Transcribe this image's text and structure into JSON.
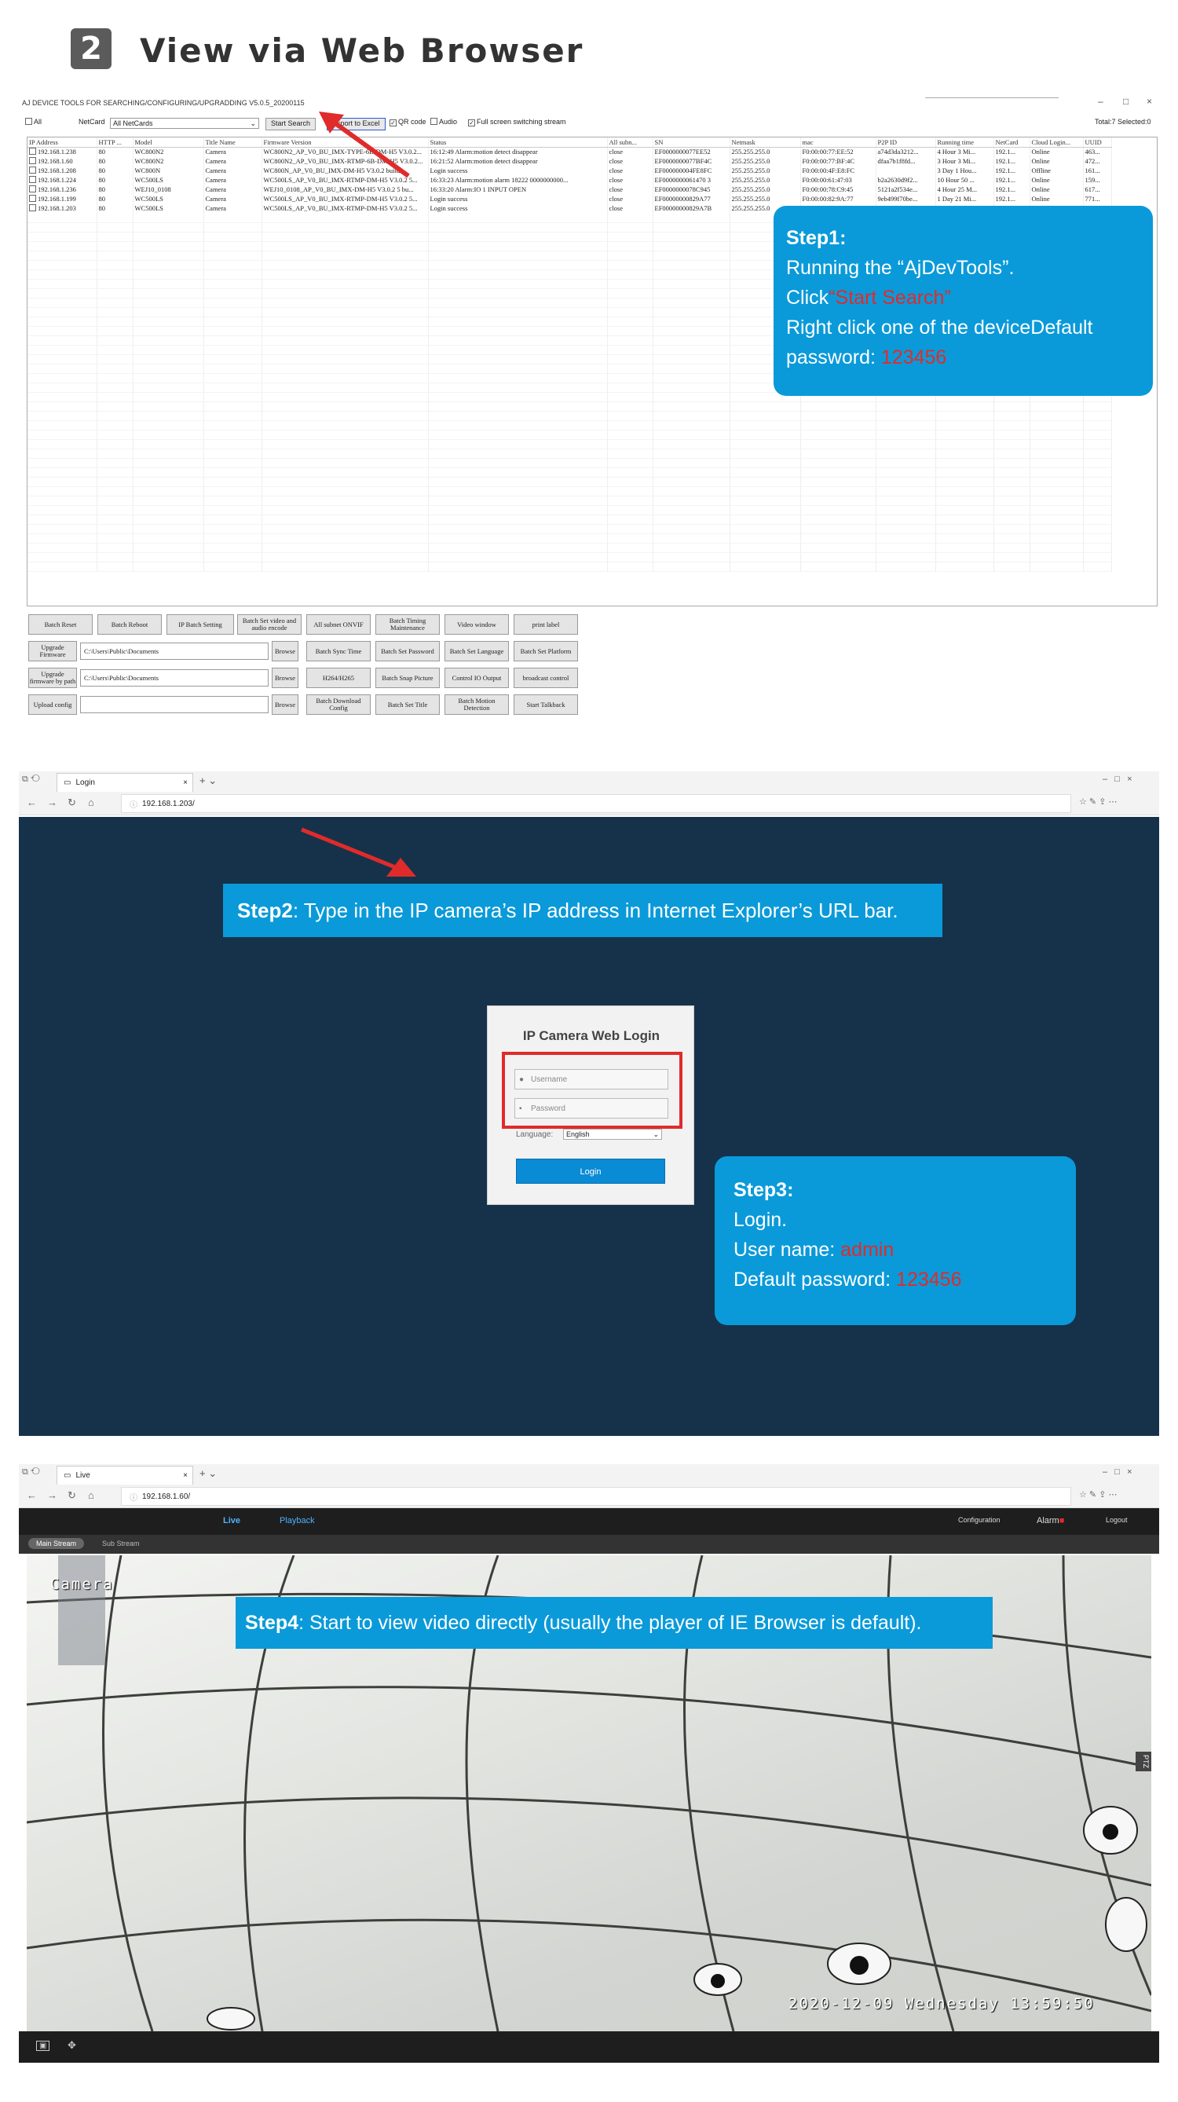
{
  "header": {
    "number": "2",
    "title": "View via Web Browser"
  },
  "tool": {
    "window_title": "AJ DEVICE TOOLS FOR SEARCHING/CONFIGURING/UPGRADDING V5.0.5_20200115",
    "controls": {
      "minimize": "–",
      "maximize": "□",
      "close": "×"
    },
    "toolbar": {
      "all_label": "All",
      "netcard_label": "NetCard",
      "netcard_value": "All NetCards",
      "start_search": "Start Search",
      "export_excel": "Export to Excel",
      "qr_code": "QR code",
      "audio": "Audio",
      "full_screen": "Full screen switching stream",
      "total": "Total:7 Selected:0"
    },
    "columns": [
      "IP Address",
      "HTTP ...",
      "Model",
      "Title Name",
      "Firmware Version",
      "Status",
      "All subn...",
      "SN",
      "Netmask",
      "mac",
      "P2P ID",
      "Running time",
      "NetCard",
      "Cloud Login...",
      "UUID"
    ],
    "rows": [
      [
        "192.168.1.238",
        "80",
        "WC800N2",
        "Camera",
        "WC800N2_AP_V0_BU_IMX-TYPE-6B-DM-H5 V3.0.2...",
        "16:12:49 Alarm:motion detect disappear",
        "close",
        "EF0000000077EE52",
        "255.255.255.0",
        "F0:00:00:77:EE:52",
        "a74d3da3212...",
        "4 Hour 3 Mi...",
        "192.1...",
        "Online",
        "463..."
      ],
      [
        "192.168.1.60",
        "80",
        "WC800N2",
        "Camera",
        "WC800N2_AP_V0_BU_IMX-RTMP-6B-DM-H5 V3.0.2...",
        "16:21:52 Alarm:motion detect disappear",
        "close",
        "EF0000000077BF4C",
        "255.255.255.0",
        "F0:00:00:77:BF:4C",
        "dfaa7b1f8fd...",
        "3 Hour 3 Mi...",
        "192.1...",
        "Online",
        "472..."
      ],
      [
        "192.168.1.208",
        "80",
        "WC800N",
        "Camera",
        "WC800N_AP_V0_BU_IMX-DM-H5 V3.0.2 build...",
        "Login success",
        "close",
        "EF000000004FE8FC",
        "255.255.255.0",
        "F0:00:00:4F:E8:FC",
        "",
        "3 Day 1 Hou...",
        "192.1...",
        "Offline",
        "161..."
      ],
      [
        "192.168.1.224",
        "80",
        "WC500LS",
        "Camera",
        "WC500LS_AP_V0_BU_IMX-RTMP-DM-H5 V3.0.2 5...",
        "16:33:23 Alarm:motion alarm 18222 0000000000...",
        "close",
        "EF0000000061470 3",
        "255.255.255.0",
        "F0:00:00:61:47:03",
        "b2a2630d9f2...",
        "10 Hour 50 ...",
        "192.1...",
        "Online",
        "159..."
      ],
      [
        "192.168.1.236",
        "80",
        "WEJ10_0108",
        "Camera",
        "WEJ10_0108_AP_V0_BU_IMX-DM-H5 V3.0.2 5 bu...",
        "16:33:20 Alarm:IO 1 INPUT OPEN",
        "close",
        "EF0000000078C945",
        "255.255.255.0",
        "F0:00:00:78:C9:45",
        "5121a2f534e...",
        "4 Hour 25 M...",
        "192.1...",
        "Online",
        "617..."
      ],
      [
        "192.168.1.199",
        "80",
        "WC500LS",
        "Camera",
        "WC500LS_AP_V0_BU_IMX-RTMP-DM-H5 V3.0.2 5...",
        "Login success",
        "close",
        "EF00000000829A77",
        "255.255.255.0",
        "F0:00:00:82:9A:77",
        "9eb499f70be...",
        "1 Day 21 Mi...",
        "192.1...",
        "Online",
        "771..."
      ],
      [
        "192.168.1.203",
        "80",
        "WC500LS",
        "Camera",
        "WC500LS_AP_V0_BU_IMX-RTMP-DM-H5 V3.0.2 5...",
        "Login success",
        "close",
        "EF00000000829A7B",
        "255.255.255.0",
        "",
        "",
        "",
        "",
        "",
        ""
      ]
    ],
    "buttons": {
      "batch_reset": "Batch Reset",
      "batch_reboot": "Batch Reboot",
      "ip_batch_setting": "IP Batch Setting",
      "batch_set_video": "Batch Set video and audio encode",
      "all_subnet_onvif": "All subnet ONVIF",
      "batch_timing": "Batch Timing Maintenance",
      "video_window": "Video window",
      "print_label": "print label",
      "upgrade_firmware": "Upgrade Firmware",
      "upgrade_firmware_path": "Upgrade firmware by path",
      "upload_config": "Upload config",
      "browse": "Browse",
      "batch_sync_time": "Batch Sync Time",
      "batch_set_password": "Batch Set Password",
      "batch_set_language": "Batch Set Language",
      "batch_set_platform": "Batch Set Platform",
      "h264_h265": "H264/H265",
      "batch_snap": "Batch Snap Picture",
      "control_io": "Control IO Output",
      "broadcast": "broadcast control",
      "batch_download": "Batch Download Config",
      "batch_set_title": "Batch Set Title",
      "batch_motion": "Batch Motion Detection",
      "start_talkback": "Start Talkback"
    },
    "paths": {
      "firmware": "C:\\Users\\Public\\Documents",
      "firmware_by_path": "C:\\Users\\Public\\Documents",
      "config": ""
    }
  },
  "step1": {
    "heading": "Step1:",
    "line1": "Running the “AjDevTools”.",
    "line2_pre": "Click",
    "line2_red": "“Start Search”",
    "line3": "Right click one of the deviceDefault",
    "line4_pre": "password: ",
    "line4_red": "123456"
  },
  "browser2": {
    "tab_title": "Login",
    "url": "192.168.1.203/",
    "step2_bold": "Step2",
    "step2_text": ": Type in the IP camera’s IP address in Internet Explorer’s URL bar.",
    "login": {
      "title": "IP Camera Web Login",
      "username_placeholder": "Username",
      "password_placeholder": "Password",
      "language_label": "Language:",
      "language_value": "English",
      "login_button": "Login"
    }
  },
  "step3": {
    "heading": "Step3:",
    "line1": "Login.",
    "line2_pre": "User name: ",
    "line2_red": "admin",
    "line3_pre": "Default password: ",
    "line3_red": "123456"
  },
  "browser3": {
    "tab_title": "Live",
    "url": "192.168.1.60/",
    "nav": {
      "live": "Live",
      "playback": "Playback",
      "configuration": "Configuration",
      "alarm": "Alarm",
      "logout": "Logout"
    },
    "streams": {
      "main": "Main Stream",
      "sub": "Sub Stream"
    },
    "osd_name": "Camera",
    "osd_time": "2020-12-09 Wednesday 13:59:50",
    "step4_bold": "Step4",
    "step4_text": ": Start to view video directly (usually the player of IE Browser is default).",
    "ptz": "PTZ"
  },
  "colors": {
    "callout": "#0a9ad9",
    "highlight": "#e02b2b",
    "login_bg": "#16324a"
  }
}
